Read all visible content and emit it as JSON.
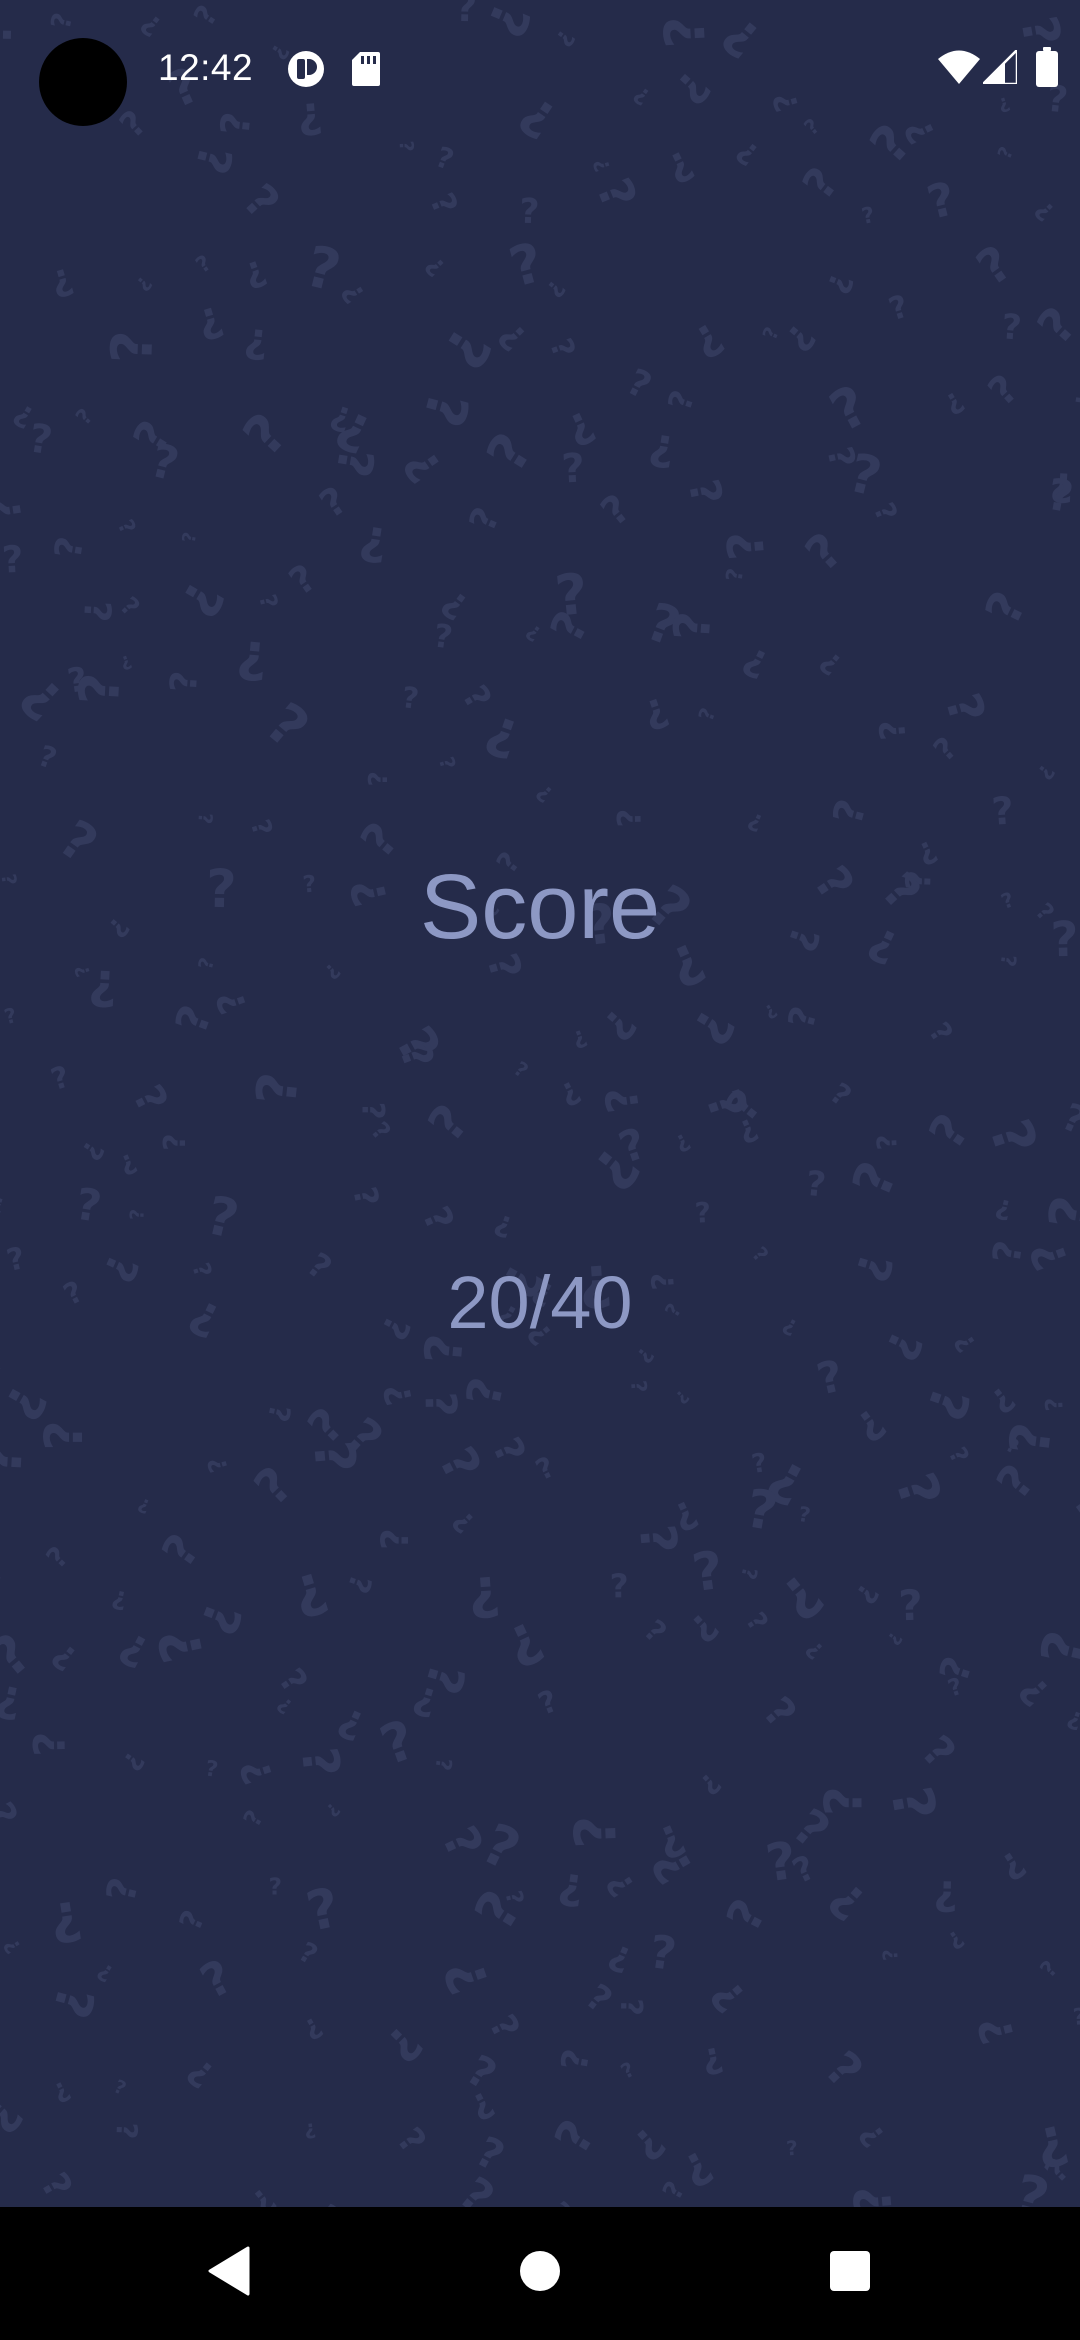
{
  "status_bar": {
    "time": "12:42",
    "left_icons": [
      "notification-app-icon",
      "sd-card-icon"
    ],
    "right_icons": [
      "wifi-icon",
      "cellular-signal-icon",
      "battery-icon"
    ]
  },
  "background": {
    "color": "#252b4a",
    "pattern_icon": "question-mark-pattern",
    "pattern_color": "#333a5c"
  },
  "score": {
    "title": "Score",
    "value": "20/40",
    "text_color": "#8d98c4"
  },
  "nav_bar": {
    "buttons": [
      "back-icon",
      "home-icon",
      "recents-icon"
    ],
    "icon_color": "#ffffff"
  }
}
